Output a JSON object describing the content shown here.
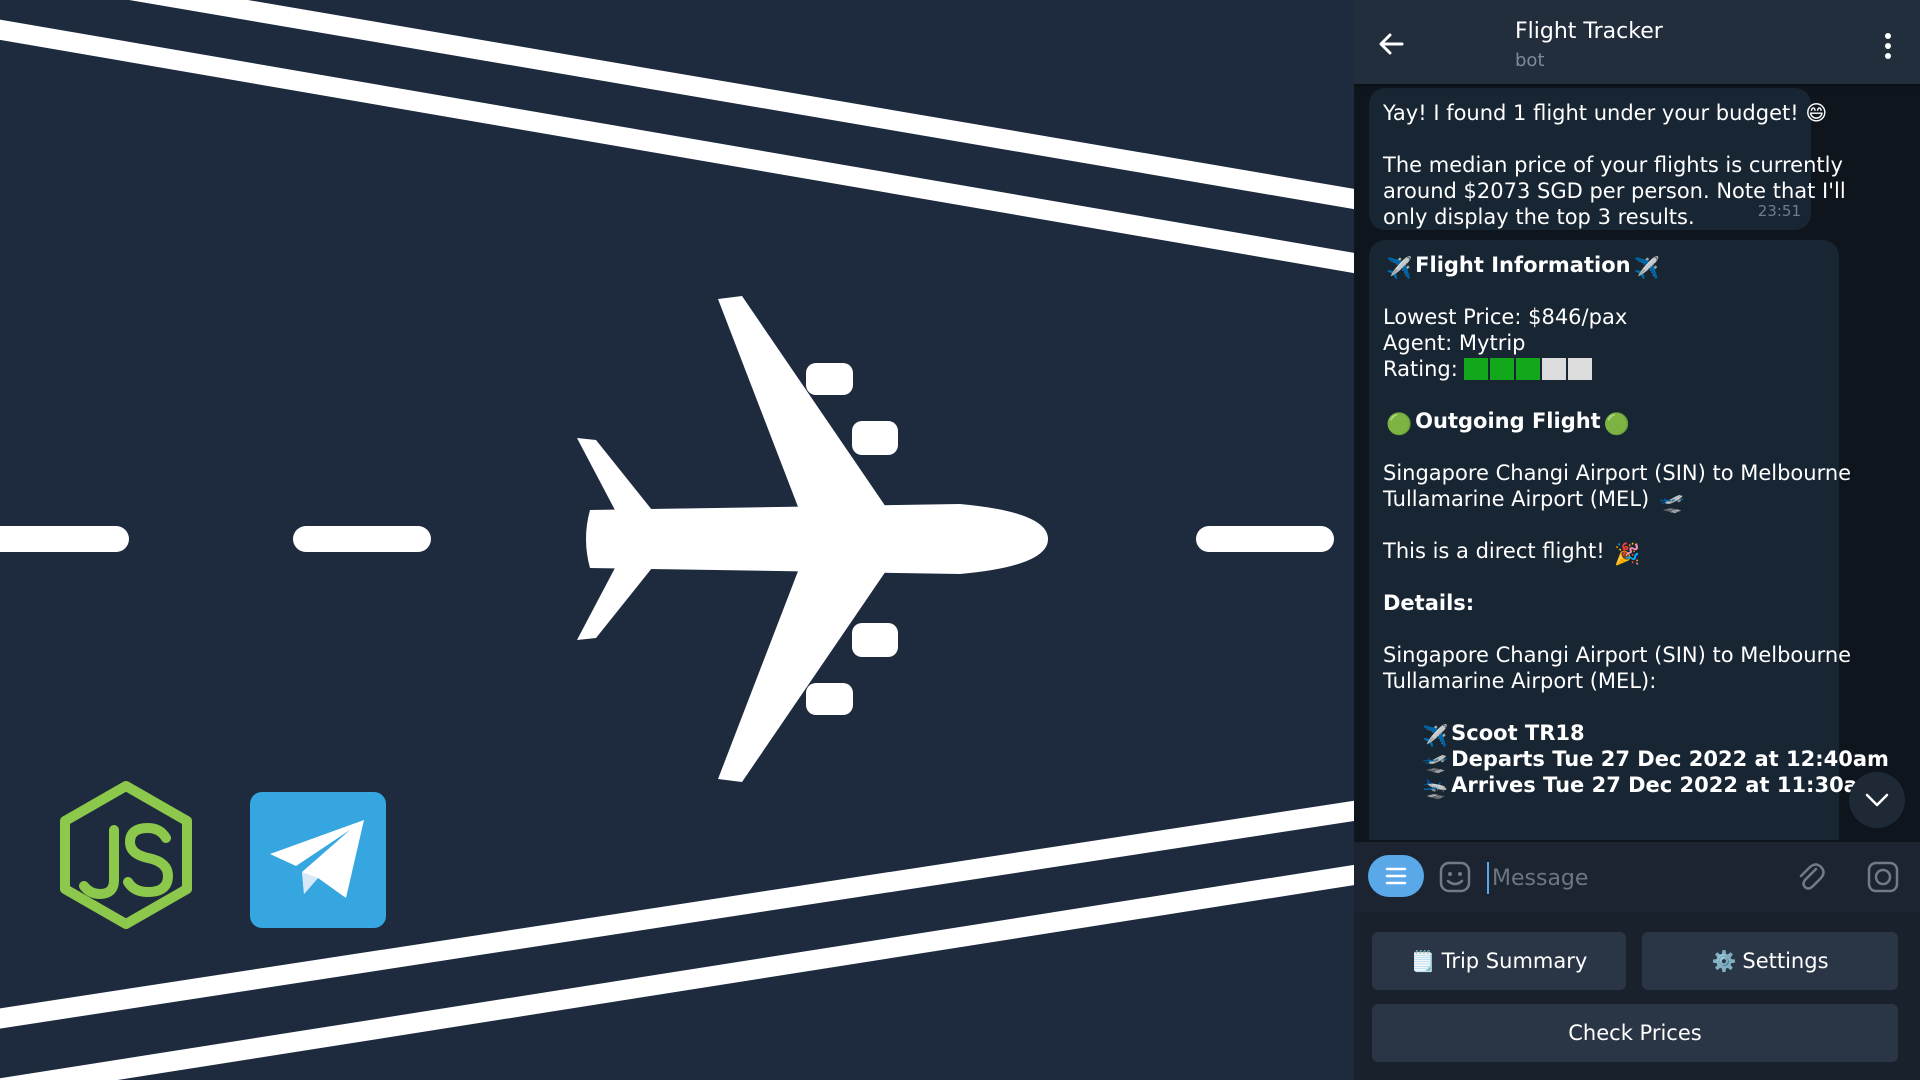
{
  "header": {
    "title": "Flight Tracker",
    "subtitle": "bot",
    "back_icon": "arrow-left-icon",
    "menu_icon": "more-vertical-icon"
  },
  "messages": {
    "first": {
      "line1": "Yay! I found 1 flight under your budget! 😄",
      "line2": "The median price of your flights is currently",
      "line3": "around $2073 SGD per person. Note that I'll",
      "line4": "only display the top 3 results.",
      "time": "23:51"
    },
    "second": {
      "title": "Flight Information",
      "lowest_price": "Lowest Price: $846/pax",
      "agent": "Agent: Mytrip",
      "rating_label": "Rating:",
      "rating": {
        "filled": 3,
        "total": 5
      },
      "outgoing_title": "Outgoing Flight",
      "route_line1": "Singapore Changi Airport (SIN) to Melbourne",
      "route_line2": "Tullamarine Airport (MEL)",
      "direct": "This is a direct flight!",
      "details_label": "Details:",
      "details_route_line1": "Singapore Changi Airport (SIN) to Melbourne",
      "details_route_line2": "Tullamarine Airport (MEL):",
      "flight_number": "Scoot TR18",
      "departs": "Departs Tue 27 Dec 2022 at 12:40am",
      "arrives": "Arrives Tue 27 Dec 2022 at 11:30am"
    }
  },
  "input": {
    "placeholder": "Message",
    "value": ""
  },
  "keyboard": {
    "trip_summary": "Trip Summary",
    "settings": "Settings",
    "check_prices": "Check Prices"
  },
  "colors": {
    "background": "#1e2b3f",
    "telegram_blue": "#35a6e0",
    "node_green": "#8cc84b",
    "bubble": "#182533",
    "accent": "#5aa8e8"
  }
}
